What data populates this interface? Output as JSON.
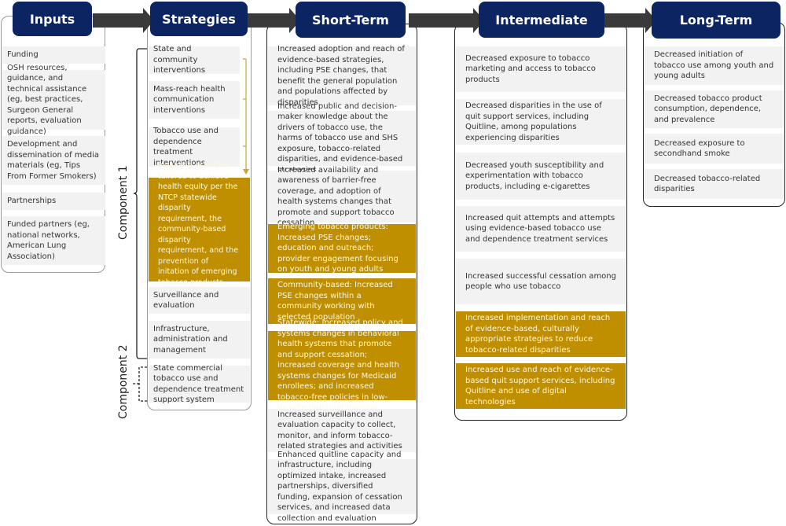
{
  "columns": {
    "inputs": {
      "title": "Inputs",
      "items": [
        "Funding",
        "OSH resources, guidance, and technical assistance (eg, best practices, Surgeon General reports, evaluation guidance)",
        "Development and dissemination of media materials (eg, Tips From Former Smokers)",
        "Partnerships",
        "Funded partners (eg, national networks, American Lung Association)"
      ]
    },
    "strategies": {
      "title": "Strategies",
      "items": [
        "State and community interventions",
        "Mass-reach health communication interventions",
        "Tobacco use and dependence treatment interventions",
        "Including activities tailored to achieve health equity per the NTCP statewide disparity requirement, the community-based disparity requirement, and the prevention of initation of emerging tobacco products requirement",
        "Surveillance and evaluation",
        "Infrastructure, administration and management",
        "State commercial tobacco use and dependence treatment support system"
      ],
      "component_labels": [
        "Component 1",
        "Component 2"
      ]
    },
    "short_term": {
      "title": "Short-Term",
      "items": [
        "Increased adoption and reach of evidence-based strategies, including PSE changes, that benefit the general population and populations affected by disparities",
        "Increased public and decision-maker knowledge about the drivers of tobacco use, the harms of tobacco use and SHS exposure, tobacco-related disparities, and evidence-based strategies",
        "Increased availability and awareness of barrier-free coverage, and adoption of health systems changes that promote and support tobacco cessation",
        "Emerging tobacco products: Increased PSE changes; education and outreach; provider engagement focusing on youth and young adults",
        "Community-based: Increased PSE changes within a community working with selected population",
        "Statewide: Increased policy and systems changes in behavioral health systems that promote and support cessation; increased coverage and health systems changes for Medicaid enrollees; and increased tobacco-free policies in low-income mulitunit housing",
        "Increased surveillance and evaluation capacity to collect, monitor, and inform tobacco-related strategies and activities",
        "Enhanced quitline capacity and infrastructure, including optimized intake, increased partnerships, diversified funding, expansion of cessation services, and increased data collection and evaluation"
      ]
    },
    "intermediate": {
      "title": "Intermediate",
      "items": [
        "Decreased exposure to tobacco marketing and access to tobacco products",
        "Decreased disparities in the use of quit support services, including Quitline, among populations experiencing disparities",
        "Decreased youth susceptibility and experimentation with tobacco products, including e-cigarettes",
        "Increased quit attempts and attempts using evidence-based tobacco use and dependence treatment services",
        "Increased successful cessation among people who use tobacco",
        "Increased implementation and reach of evidence-based, culturally appropriate strategies to reduce tobacco-related disparities",
        "Increased use and reach of evidence-based quit support services, including Quitline and use of digital technologies"
      ]
    },
    "long_term": {
      "title": "Long-Term",
      "items": [
        "Decreased initiation of tobacco use among youth and young adults",
        "Decreased tobacco product consumption, dependence, and prevalence",
        "Decreased exposure to secondhand smoke",
        "Decreased tobacco-related disparities"
      ]
    }
  },
  "colors": {
    "header_bg": "#0c2461",
    "highlight_gold": "#bf8f00",
    "item_bg": "#f2f2f2",
    "arrow": "#3a3a3a"
  }
}
